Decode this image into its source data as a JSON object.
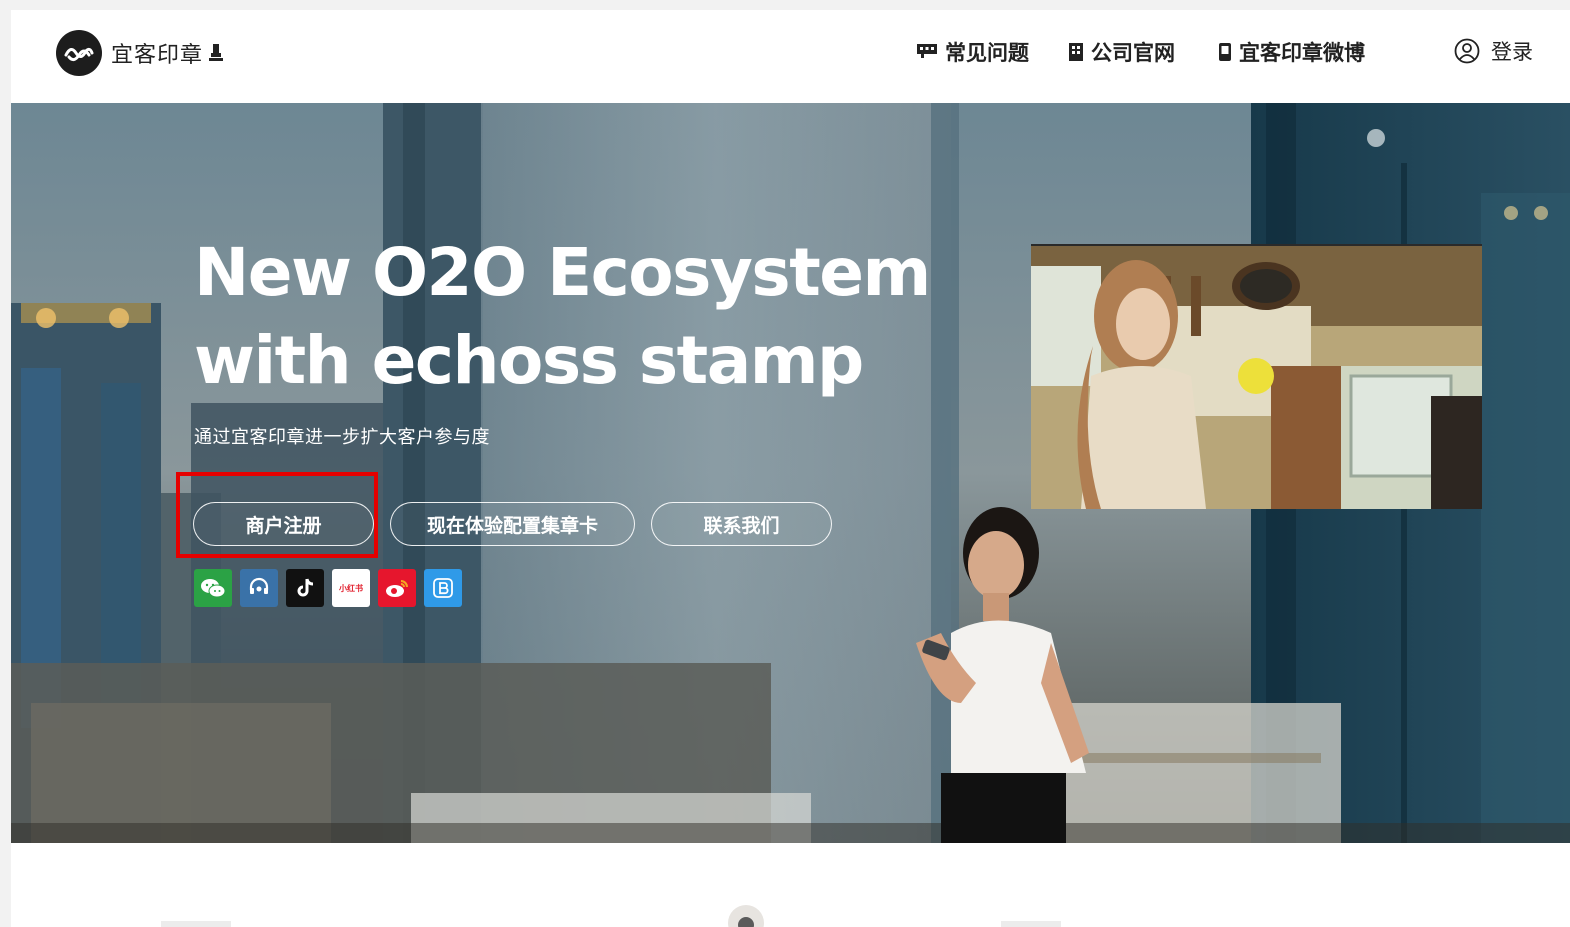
{
  "header": {
    "logo_text": "宜客印章",
    "nav": {
      "faq": "常见问题",
      "official_site": "公司官网",
      "weibo": "宜客印章微博",
      "login": "登录"
    }
  },
  "hero": {
    "title_line1": "New O2O Ecosystem",
    "title_line2": "with echoss stamp",
    "subtitle": "通过宜客印章进一步扩大客户参与度",
    "buttons": {
      "register": "商户注册",
      "trial": "现在体验配置集章卡",
      "contact": "联系我们"
    },
    "social_icons": [
      "wechat-icon",
      "customer-service-icon",
      "tiktok-icon",
      "xiaohongshu-icon",
      "weibo-icon",
      "bilibili-icon"
    ],
    "xhs_label": "小红书"
  },
  "colors": {
    "highlight": "#e50000",
    "wechat": "#2ba245",
    "service": "#3a72a8",
    "tiktok": "#111111",
    "weibo": "#e6162d",
    "bilibili": "#2f9ae8"
  }
}
